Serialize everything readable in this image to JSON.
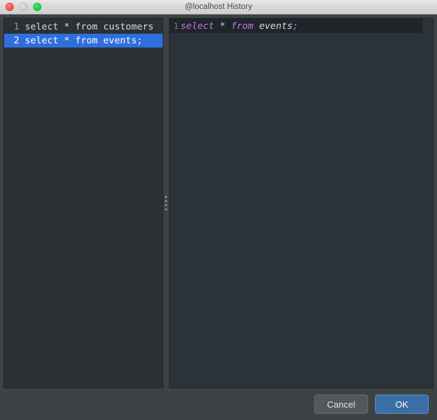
{
  "window": {
    "title": "@localhost History",
    "traffic_lights": [
      {
        "name": "close-button",
        "color": "#fb5a52"
      },
      {
        "name": "minimize-button",
        "color": "#d2d0d1"
      },
      {
        "name": "maximize-button",
        "color": "#22cf40"
      }
    ]
  },
  "history_panel": {
    "items": [
      {
        "line": "1",
        "sql": "select * from customers",
        "selected": false
      },
      {
        "line": "2",
        "sql": "select * from events;",
        "selected": true
      }
    ]
  },
  "editor_panel": {
    "lines": [
      {
        "gutter": "1",
        "tokens": [
          {
            "text": "select",
            "type": "keyword"
          },
          {
            "text": " ",
            "type": "plain"
          },
          {
            "text": "*",
            "type": "operator"
          },
          {
            "text": " ",
            "type": "plain"
          },
          {
            "text": "from",
            "type": "keyword"
          },
          {
            "text": " ",
            "type": "plain"
          },
          {
            "text": "events",
            "type": "identifier"
          },
          {
            "text": ";",
            "type": "punctuation"
          }
        ]
      }
    ]
  },
  "splitter": {
    "dot_count": 4
  },
  "footer": {
    "cancel_label": "Cancel",
    "ok_label": "OK"
  },
  "colors": {
    "selection_blue": "#2f6fdd",
    "ok_button_blue": "#3b6ea5",
    "keyword_purple": "#c974e0",
    "editor_background": "#2b3338",
    "list_background": "#2b3034",
    "current_line": "#1e252b",
    "chrome": "#3d4245"
  }
}
